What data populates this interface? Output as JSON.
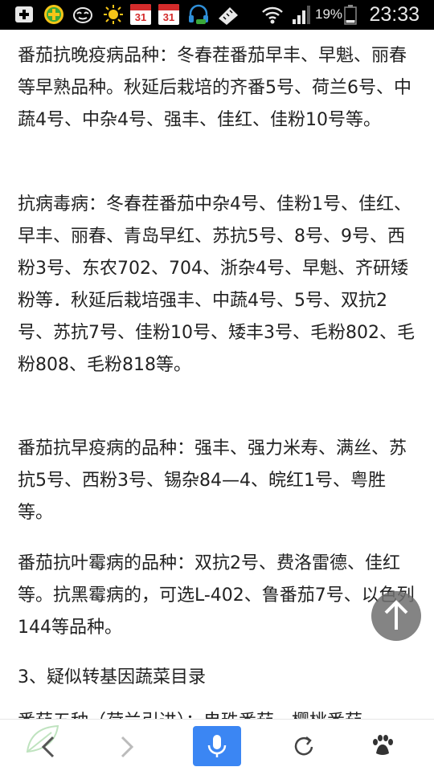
{
  "status_bar": {
    "battery_percent": "19%",
    "time": "23:33",
    "calendar_day_1": "31",
    "calendar_day_2": "31",
    "icons": [
      "add-icon",
      "plus-circle-icon",
      "cat-icon",
      "sun-icon",
      "calendar-icon",
      "calendar-icon",
      "headset-icon",
      "ruler-icon",
      "wifi-icon",
      "signal-icon",
      "battery-icon"
    ]
  },
  "article": {
    "paragraphs": [
      "番茄抗晚疫病品种：冬春茬番茄早丰、早魁、丽春等早熟品种。秋延后栽培的齐番5号、荷兰6号、中蔬4号、中杂4号、强丰、佳红、佳粉10号等。",
      "抗病毒病：冬春茬番茄中杂4号、佳粉1号、佳红、早丰、丽春、青岛早红、苏抗5号、8号、9号、西粉3号、东农702、704、浙杂4号、早魁、齐研矮粉等．秋延后栽培强丰、中蔬4号、5号、双抗2号、苏抗7号、佳粉10号、矮丰3号、毛粉802、毛粉808、毛粉818等。",
      "番茄抗早疫病的品种：强丰、强力米寿、满丝、苏抗5号、西粉3号、锡杂84—4、皖红1号、粤胜等。",
      "番茄抗叶霉病的品种：双抗2号、费洛雷德、佳红等。抗黑霉病的，可选L-402、鲁番茄7号、以色列144等品种。",
      "3、疑似转基因蔬菜目录",
      "番茄五种（荷兰引进）：串珠番茄、樱桃番茄"
    ]
  },
  "accent_colors": {
    "mic_button": "#3b86f3",
    "status_bar": "#000000",
    "battery_level": "#e8e8e8"
  },
  "toolbar": {
    "icons": [
      "back-arrow-icon",
      "forward-arrow-icon",
      "microphone-icon",
      "refresh-icon",
      "paw-icon"
    ]
  }
}
